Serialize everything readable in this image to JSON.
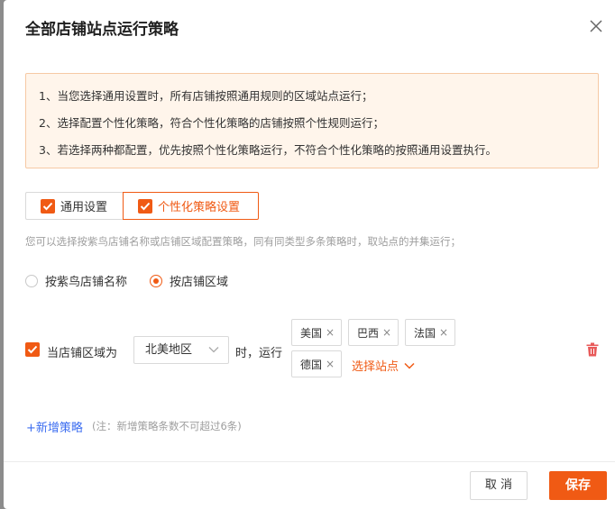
{
  "dialog": {
    "title": "全部店铺站点运行策略"
  },
  "notice": {
    "lines": [
      "1、当您选择通用设置时，所有店铺按照通用规则的区域站点运行；",
      "2、选择配置个性化策略，符合个性化策略的店铺按照个性规则运行；",
      "3、若选择两种都配置，优先按照个性化策略运行，不符合个性化策略的按照通用设置执行。"
    ]
  },
  "mode": {
    "general_label": "通用设置",
    "custom_label": "个性化策略设置",
    "general_checked": true,
    "custom_checked": true
  },
  "hint": "您可以选择按紫鸟店铺名称或店铺区域配置策略，同有同类型多条策略时，取站点的并集运行；",
  "match_by": {
    "options": [
      "按紫鸟店铺名称",
      "按店铺区域"
    ],
    "selected": "按店铺区域"
  },
  "rule": {
    "prefix": "当店铺区域为",
    "region": "北美地区",
    "middle": "时，运行",
    "sites": [
      "美国",
      "巴西",
      "法国",
      "德国"
    ],
    "remove_glyph": "×",
    "pick_label": "选择站点"
  },
  "add": {
    "label": "+新增策略",
    "note": "(注：新增策略条数不可超过6条)"
  },
  "footer": {
    "cancel_label": "取 消",
    "save_label": "保存"
  },
  "colors": {
    "accent": "#f05a14",
    "link": "#3d6ef0",
    "notice_bg": "#fff5eb",
    "delete": "#e85a5a"
  }
}
